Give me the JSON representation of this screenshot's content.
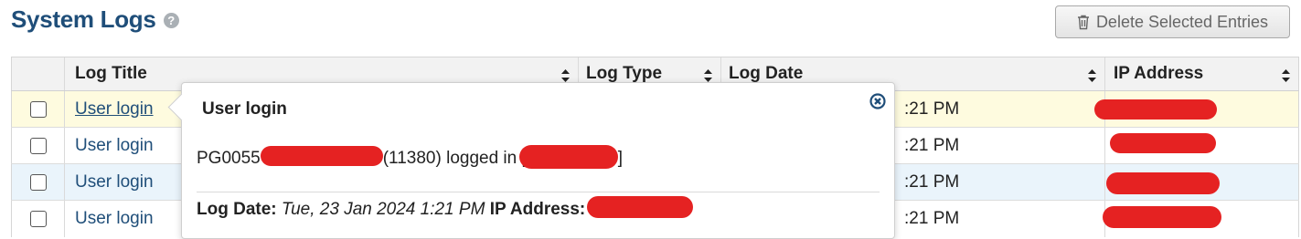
{
  "header": {
    "title": "System Logs",
    "help_icon": "question-circle-icon",
    "delete_button": "Delete Selected Entries",
    "delete_icon": "trash-icon"
  },
  "table": {
    "columns": [
      "Log Title",
      "Log Type",
      "Log Date",
      "IP Address"
    ],
    "rows": [
      {
        "title": "User login",
        "date_tail": ":21 PM"
      },
      {
        "title": "User login",
        "date_tail": ":21 PM"
      },
      {
        "title": "User login",
        "date_tail": ":21 PM"
      },
      {
        "title": "User login",
        "date_tail": ":21 PM"
      }
    ]
  },
  "popover": {
    "title": "User login",
    "message_prefix": "PG0055",
    "message_mid": "(11380) logged in [",
    "message_suffix": "]",
    "log_date_label": "Log Date:",
    "log_date_value": "Tue, 23 Jan 2024 1:21 PM",
    "ip_label": "IP Address:",
    "close_icon": "close-circle-icon"
  },
  "colors": {
    "title": "#1f4e79",
    "link": "#1f4e79",
    "highlight_row": "#fefbdf",
    "alt_row": "#eaf4fb",
    "redaction": "#e52222"
  }
}
